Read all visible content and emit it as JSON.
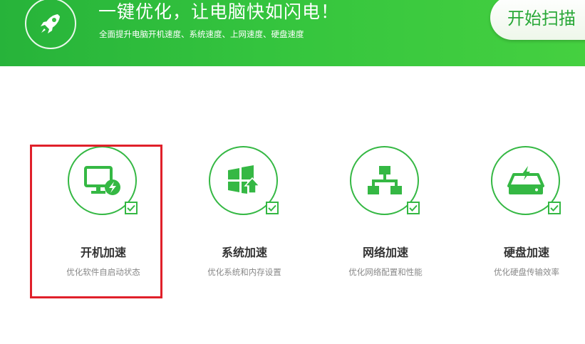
{
  "banner": {
    "headline": "一键优化，让电脑快如闪电！",
    "subline": "全面提升电脑开机速度、系统速度、上网速度、硬盘速度",
    "scan_button": "开始扫描"
  },
  "features": [
    {
      "title": "开机加速",
      "desc": "优化软件自启动状态",
      "icon": "monitor-bolt-icon",
      "checked": true
    },
    {
      "title": "系统加速",
      "desc": "优化系统和内存设置",
      "icon": "windows-up-icon",
      "checked": true
    },
    {
      "title": "网络加速",
      "desc": "优化网络配置和性能",
      "icon": "network-tree-icon",
      "checked": true
    },
    {
      "title": "硬盘加速",
      "desc": "优化硬盘传输效率",
      "icon": "disk-bolt-icon",
      "checked": true
    }
  ],
  "colors": {
    "accent": "#35b844",
    "highlight": "#e0202a"
  }
}
